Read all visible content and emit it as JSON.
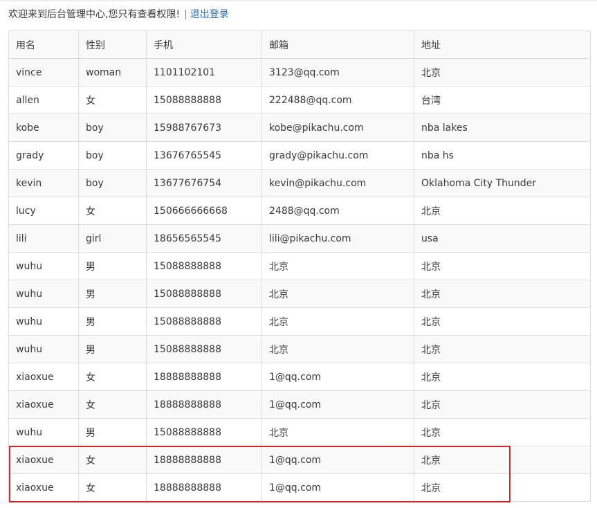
{
  "header": {
    "welcome_text": "欢迎来到后台管理中心,您只有查看权限!",
    "separator": "|",
    "logout_label": "退出登录"
  },
  "table": {
    "columns": [
      "用名",
      "性别",
      "手机",
      "邮箱",
      "地址"
    ],
    "rows": [
      [
        "vince",
        "woman",
        "1101102101",
        "3123@qq.com",
        "北京"
      ],
      [
        "allen",
        "女",
        "15088888888",
        "222488@qq.com",
        "台湾"
      ],
      [
        "kobe",
        "boy",
        "15988767673",
        "kobe@pikachu.com",
        "nba lakes"
      ],
      [
        "grady",
        "boy",
        "13676765545",
        "grady@pikachu.com",
        "nba hs"
      ],
      [
        "kevin",
        "boy",
        "13677676754",
        "kevin@pikachu.com",
        "Oklahoma City Thunder"
      ],
      [
        "lucy",
        "女",
        "150666666668",
        "2488@qq.com",
        "北京"
      ],
      [
        "lili",
        "girl",
        "18656565545",
        "lili@pikachu.com",
        "usa"
      ],
      [
        "wuhu",
        "男",
        "15088888888",
        "北京",
        "北京"
      ],
      [
        "wuhu",
        "男",
        "15088888888",
        "北京",
        "北京"
      ],
      [
        "wuhu",
        "男",
        "15088888888",
        "北京",
        "北京"
      ],
      [
        "wuhu",
        "男",
        "15088888888",
        "北京",
        "北京"
      ],
      [
        "xiaoxue",
        "女",
        "18888888888",
        "1@qq.com",
        "北京"
      ],
      [
        "xiaoxue",
        "女",
        "18888888888",
        "1@qq.com",
        "北京"
      ],
      [
        "wuhu",
        "男",
        "15088888888",
        "北京",
        "北京"
      ],
      [
        "xiaoxue",
        "女",
        "18888888888",
        "1@qq.com",
        "北京"
      ],
      [
        "xiaoxue",
        "女",
        "18888888888",
        "1@qq.com",
        "北京"
      ]
    ]
  },
  "colors": {
    "link": "#2a6ebb",
    "highlight_border": "#d9232d",
    "stripe": "#f9f9f9",
    "border": "#dddddd"
  }
}
